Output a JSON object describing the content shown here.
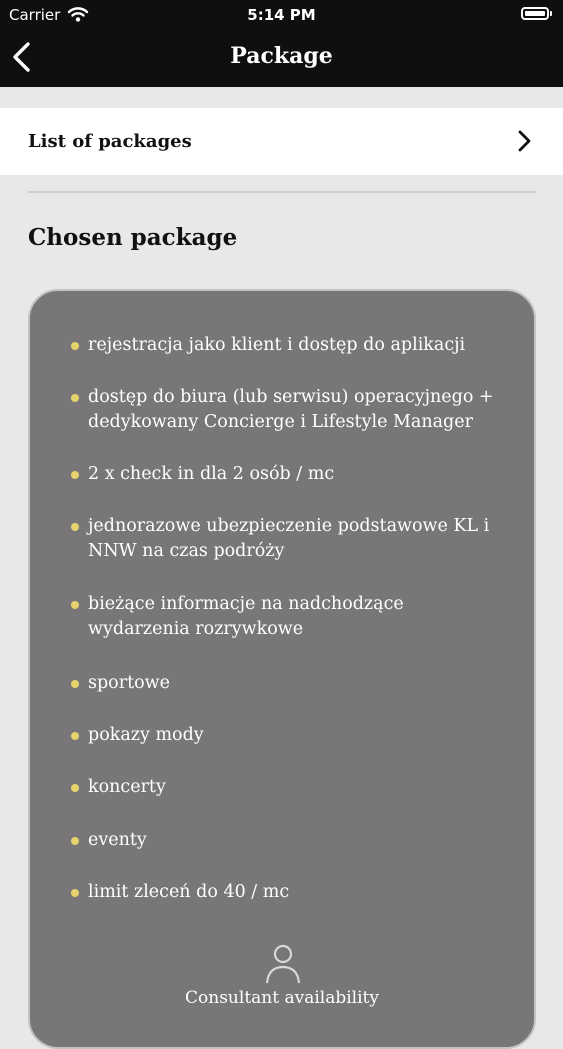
{
  "status_bar": {
    "carrier": "Carrier",
    "time": "5:14 PM"
  },
  "nav": {
    "title": "Package",
    "back_icon": "chevron-left-icon"
  },
  "list_row": {
    "label": "List of packages",
    "icon": "chevron-right-icon"
  },
  "section": {
    "title": "Chosen package"
  },
  "features": [
    {
      "lines": [
        "rejestracja jako klient i dostęp do aplikacji"
      ]
    },
    {
      "lines": [
        "dostęp do biura (lub serwisu) operacyjnego +",
        "dedykowany Concierge i Lifestyle Manager"
      ]
    },
    {
      "lines": [
        "2 x check in dla 2 osób / mc"
      ]
    },
    {
      "lines": [
        "jednorazowe ubezpieczenie podstawowe KL i",
        "NNW na czas podróży"
      ]
    },
    {
      "lines": [
        "bieżące informacje na nadchodzące",
        "wydarzenia rozrywkowe"
      ]
    },
    {
      "lines": [
        "sportowe"
      ]
    },
    {
      "lines": [
        "pokazy mody"
      ]
    },
    {
      "lines": [
        "koncerty"
      ]
    },
    {
      "lines": [
        "eventy"
      ]
    },
    {
      "lines": [
        "limit zleceń do 40 / mc"
      ]
    }
  ],
  "consultant": {
    "label": "Consultant availability",
    "icon": "person-icon"
  },
  "colors": {
    "bar": "#0f0f0f",
    "card": "#787679",
    "bullet": "#e6d36b",
    "background": "#e9e8e9"
  }
}
